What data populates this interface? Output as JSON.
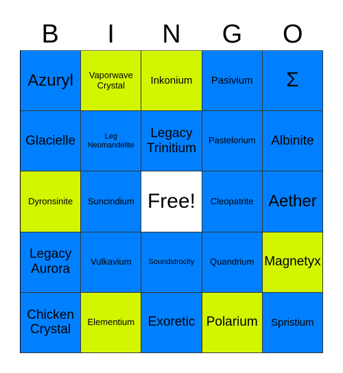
{
  "header": [
    "B",
    "I",
    "N",
    "G",
    "O"
  ],
  "colors": {
    "blue": "#0080ff",
    "green": "#d2f500",
    "free": "#ffffff"
  },
  "cells": [
    {
      "text": "Azuryl",
      "color": "blue",
      "size": "xl"
    },
    {
      "text": "Vaporwave Crystal",
      "color": "green",
      "size": "sm"
    },
    {
      "text": "Inkonium",
      "color": "green",
      "size": "md"
    },
    {
      "text": "Pasivium",
      "color": "blue",
      "size": "md"
    },
    {
      "text": "Σ",
      "color": "blue",
      "size": "xxl"
    },
    {
      "text": "Glacielle",
      "color": "blue",
      "size": "lg"
    },
    {
      "text": "Leg Neomandelite",
      "color": "blue",
      "size": "xs"
    },
    {
      "text": "Legacy Trinitium",
      "color": "blue",
      "size": "lg"
    },
    {
      "text": "Pastelorium",
      "color": "blue",
      "size": "sm"
    },
    {
      "text": "Albinite",
      "color": "blue",
      "size": "lg"
    },
    {
      "text": "Dyronsinite",
      "color": "green",
      "size": "sm"
    },
    {
      "text": "Suncindium",
      "color": "blue",
      "size": "sm"
    },
    {
      "text": "Free!",
      "color": "white",
      "size": "xxl"
    },
    {
      "text": "Cleopatrite",
      "color": "blue",
      "size": "sm"
    },
    {
      "text": "Aether",
      "color": "blue",
      "size": "xl"
    },
    {
      "text": "Legacy Aurora",
      "color": "blue",
      "size": "lg"
    },
    {
      "text": "Vulkavium",
      "color": "blue",
      "size": "sm"
    },
    {
      "text": "Soundstrocity",
      "color": "blue",
      "size": "xs"
    },
    {
      "text": "Quandrium",
      "color": "blue",
      "size": "sm"
    },
    {
      "text": "Magnetyx",
      "color": "green",
      "size": "lg"
    },
    {
      "text": "Chicken Crystal",
      "color": "blue",
      "size": "lg"
    },
    {
      "text": "Elementium",
      "color": "green",
      "size": "sm"
    },
    {
      "text": "Exoretic",
      "color": "blue",
      "size": "lg"
    },
    {
      "text": "Polarium",
      "color": "green",
      "size": "lg"
    },
    {
      "text": "Spristium",
      "color": "blue",
      "size": "md"
    }
  ]
}
